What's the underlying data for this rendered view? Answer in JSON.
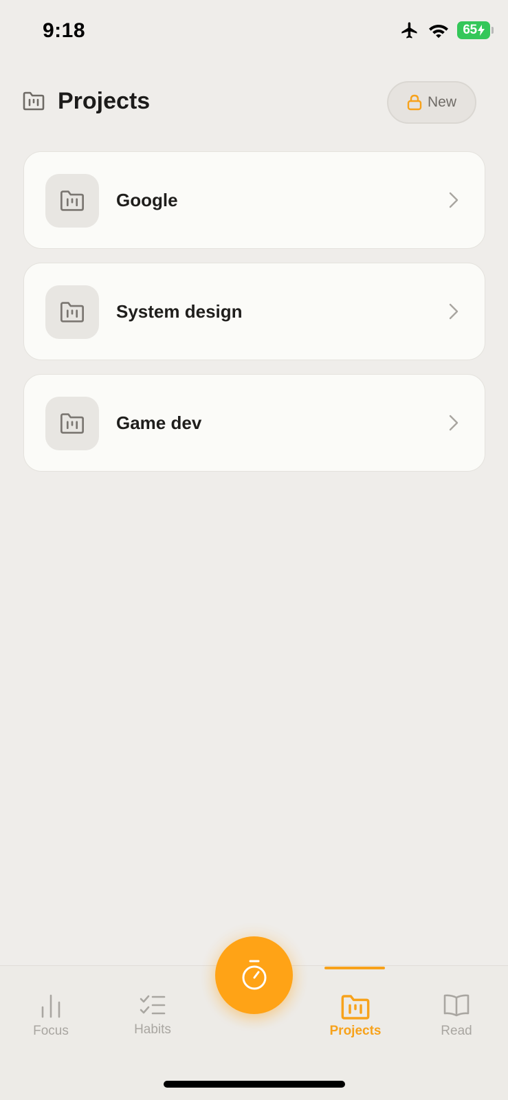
{
  "status_bar": {
    "time": "9:18",
    "battery_level": "65",
    "icons": [
      "airplane-icon",
      "wifi-icon",
      "battery-charging-icon"
    ]
  },
  "header": {
    "icon": "folder-chart-icon",
    "title": "Projects",
    "new_button": {
      "label": "New",
      "icon": "lock-icon"
    }
  },
  "projects": [
    {
      "name": "Google",
      "icon": "folder-chart-icon"
    },
    {
      "name": "System design",
      "icon": "folder-chart-icon"
    },
    {
      "name": "Game dev",
      "icon": "folder-chart-icon"
    }
  ],
  "fab": {
    "icon": "stopwatch-icon"
  },
  "tab_bar": {
    "tabs": [
      {
        "label": "Focus",
        "icon": "bar-chart-icon",
        "active": false
      },
      {
        "label": "Habits",
        "icon": "checklist-icon",
        "active": false
      },
      {
        "label": "Projects",
        "icon": "folder-chart-icon",
        "active": true
      },
      {
        "label": "Read",
        "icon": "book-icon",
        "active": false
      }
    ]
  },
  "colors": {
    "accent": "#F7A21B",
    "fab": "#FFA316",
    "background": "#EFEDEA",
    "card": "#FBFBF8",
    "inactive": "#A9A6A1"
  }
}
